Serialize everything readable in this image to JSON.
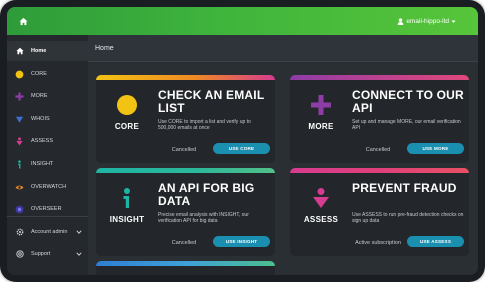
{
  "topbar": {
    "user_label": "email-hippo-ltd"
  },
  "sidebar": {
    "items": [
      {
        "label": "Home"
      },
      {
        "label": "CORE"
      },
      {
        "label": "MORE"
      },
      {
        "label": "WHOIS"
      },
      {
        "label": "ASSESS"
      },
      {
        "label": "INSIGHT"
      },
      {
        "label": "OVERWATCH"
      },
      {
        "label": "OVERSEER"
      },
      {
        "label": "Account admin"
      },
      {
        "label": "Support"
      }
    ]
  },
  "main": {
    "title": "Home",
    "cards": [
      {
        "badge": "CORE",
        "title": "CHECK AN EMAIL LIST",
        "description": "Use CORE to import a list and verify up to 500,000 emails at once",
        "status": "Cancelled",
        "button": "USE CORE"
      },
      {
        "badge": "MORE",
        "title": "CONNECT TO OUR API",
        "description": "Set up and manage MORE, our email verification API",
        "status": "Cancelled",
        "button": "USE MORE"
      },
      {
        "badge": "INSIGHT",
        "title": "AN API FOR BIG DATA",
        "description": "Precise email analysis with INSIGHT, our verification API for big data",
        "status": "Cancelled",
        "button": "USE INSIGHT"
      },
      {
        "badge": "ASSESS",
        "title": "PREVENT FRAUD",
        "description": "Use ASSESS to run pre-fraud detection checks on sign up data",
        "status": "Active subscription",
        "button": "USE ASSESS"
      }
    ]
  },
  "colors": {
    "topbar_green": "#3fb43c",
    "cta_blue": "#1a8fb0",
    "core_yellow": "#f2c313",
    "more_purple": "#8e3ca6",
    "insight_teal": "#1db5a4",
    "assess_pink": "#d63c8f"
  },
  "icons": {
    "home": "home-icon",
    "user": "user-icon",
    "core": "yellow-circle-icon",
    "more": "purple-plus-icon",
    "insight": "teal-i-icon",
    "assess": "pink-arrow-down-icon"
  }
}
